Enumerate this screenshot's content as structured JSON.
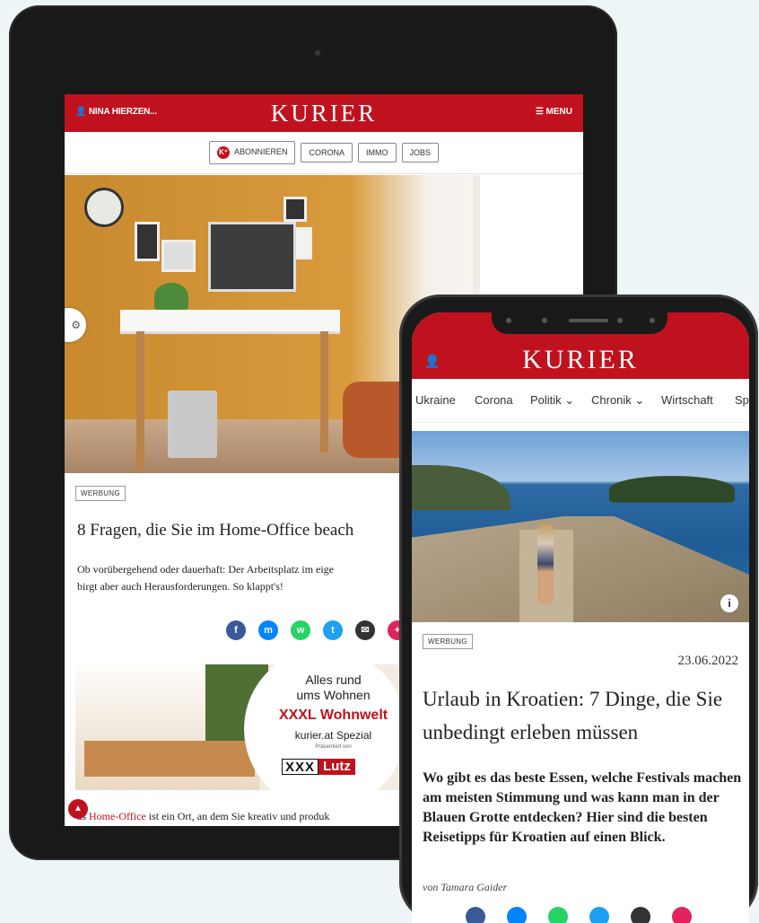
{
  "tablet": {
    "user_label": "NINA HIERZEN...",
    "logo": "KURIER",
    "menu_label": "☰ MENU",
    "nav": {
      "subscribe": "ABONNIEREN",
      "items": [
        "CORONA",
        "IMMO",
        "JOBS"
      ]
    },
    "badge": "WERBUNG",
    "headline": "8 Fragen, die Sie im Home-Office beach",
    "summary_line1": "Ob vorübergehend oder dauerhaft: Der Arbeitsplatz im eige",
    "summary_line2": "birgt aber auch Herausforderungen. So klappt's!",
    "ad": {
      "line1": "Alles rund",
      "line2": "ums Wohnen",
      "brand": "XXXL Wohnwelt",
      "site": "kurier.at Spezial",
      "presented": "Präsentiert von",
      "logo_a": "XXX",
      "logo_b": "Lutz"
    },
    "body_pre": "as ",
    "body_link": "Home-Office",
    "body_post": " ist ein Ort, an dem Sie kreativ und produk"
  },
  "phone": {
    "logo": "KURIER",
    "nav": [
      "Ukraine",
      "Corona",
      "Politik ⌄",
      "Chronik ⌄",
      "Wirtschaft",
      "Sp"
    ],
    "badge": "WERBUNG",
    "date": "23.06.2022",
    "headline": "Urlaub in Kroatien: 7 Dinge, die Sie unbedingt erleben müssen",
    "summary": "Wo gibt es das beste Essen, welche Festivals machen am meisten Stimmung und was kann man in der Blauen Grotte entdecken? Hier sind die besten Reisetipps für Kroatien auf einen Blick.",
    "author": "von Tamara Gaider"
  },
  "colors": {
    "brand_red": "#c0121e",
    "facebook": "#3b5998",
    "messenger": "#0084ff",
    "whatsapp": "#25d366",
    "twitter": "#1da1f2",
    "email": "#333333"
  },
  "icons": [
    "user-icon",
    "menu-icon",
    "k-plus-icon",
    "settings-icon",
    "facebook-icon",
    "messenger-icon",
    "whatsapp-icon",
    "twitter-icon",
    "email-icon",
    "info-icon"
  ]
}
